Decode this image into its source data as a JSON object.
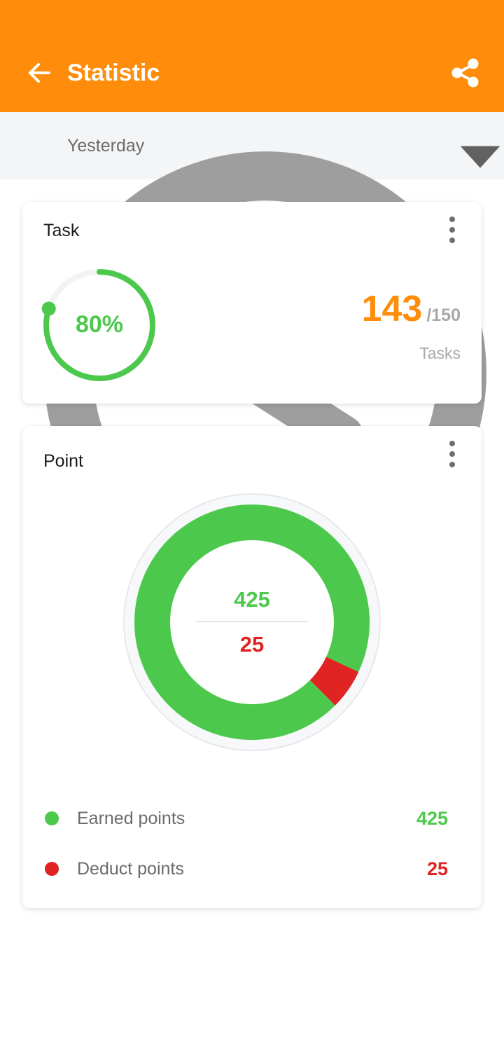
{
  "colors": {
    "primary": "#FF8C0A",
    "earned": "#4CC94C",
    "deduct": "#E02424",
    "track": "#F2F3F5"
  },
  "appbar": {
    "title": "Statistic",
    "back_icon": "arrow-left-icon",
    "share_icon": "share-icon"
  },
  "filter": {
    "icon": "clock-icon",
    "selected": "Yesterday",
    "dropdown_icon": "caret-down-icon"
  },
  "task_card": {
    "title": "Task",
    "more_icon": "more-vertical-icon",
    "percent": "80%",
    "progress": 0.8,
    "completed": "143",
    "total": "/150",
    "unit": "Tasks"
  },
  "point_card": {
    "title": "Point",
    "more_icon": "more-vertical-icon",
    "center_earned": "425",
    "center_deduct": "25",
    "legend": [
      {
        "label": "Earned points",
        "value": "425"
      },
      {
        "label": "Deduct points",
        "value": "25"
      }
    ]
  },
  "chart_data": {
    "type": "pie",
    "categories": [
      "Earned points",
      "Deduct points"
    ],
    "values": [
      425,
      25
    ]
  }
}
